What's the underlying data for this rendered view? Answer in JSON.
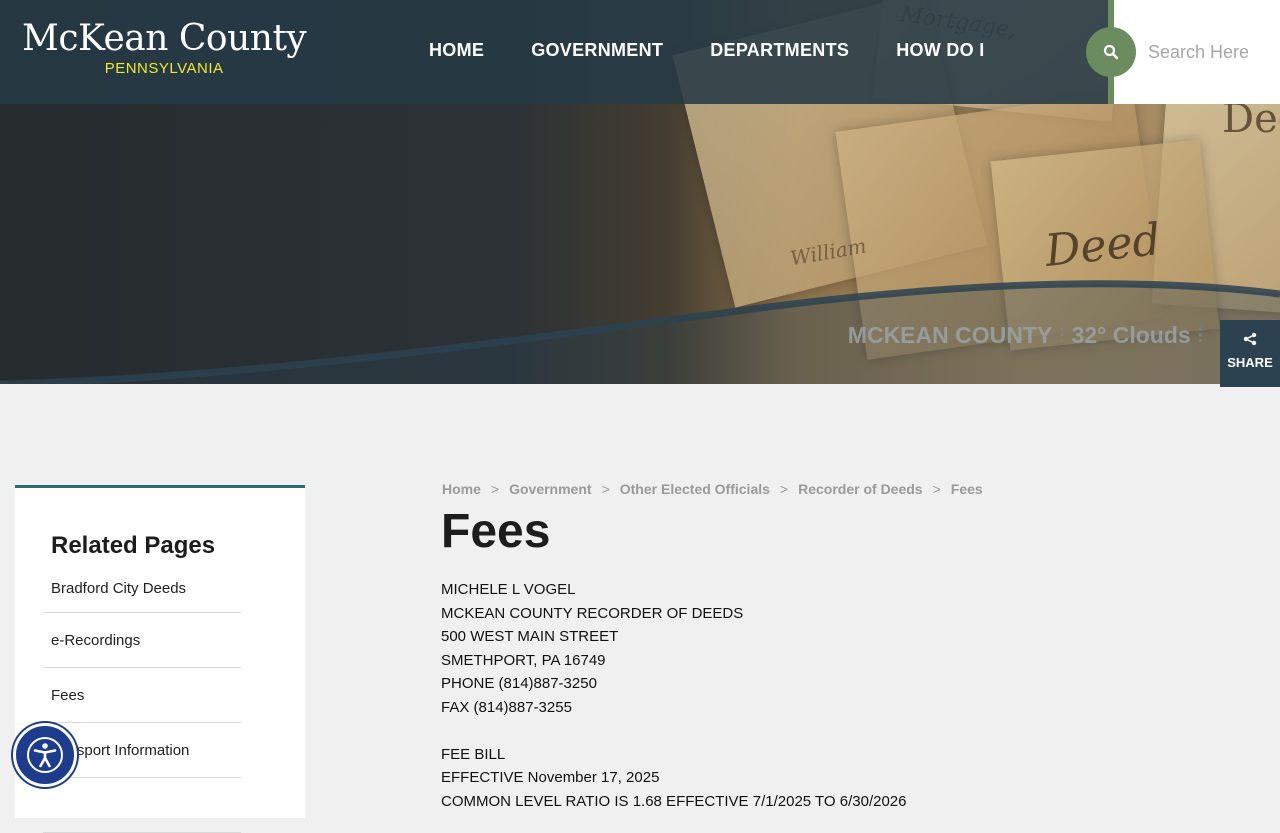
{
  "header": {
    "logo_title": "McKean County",
    "logo_subtitle": "PENNSYLVANIA",
    "nav": [
      "HOME",
      "GOVERNMENT",
      "DEPARTMENTS",
      "HOW DO I"
    ],
    "search_placeholder": "Search Here",
    "search_icon": "search-icon"
  },
  "hero": {
    "weather_location": "MCKEAN COUNTY",
    "weather_text": "32° Clouds",
    "separator": "⁝"
  },
  "share": {
    "label": "SHARE",
    "icon": "share-icon"
  },
  "sidebar": {
    "title": "Related Pages",
    "items": [
      "Bradford City Deeds",
      "e-Recordings",
      "Fees",
      "Passport Information",
      ""
    ]
  },
  "breadcrumb": [
    "Home",
    "Government",
    "Other Elected Officials",
    "Recorder of Deeds",
    "Fees"
  ],
  "breadcrumb_separator": ">",
  "page": {
    "title": "Fees",
    "address_lines": [
      "MICHELE L VOGEL",
      "MCKEAN COUNTY RECORDER OF DEEDS",
      "500 WEST MAIN STREET",
      "SMETHPORT, PA  16749",
      "PHONE (814)887-3250",
      "FAX (814)887-3255"
    ],
    "fee_lines": [
      "FEE BILL",
      "EFFECTIVE November 17, 2025",
      "COMMON LEVEL RATIO IS 1.68 EFFECTIVE 7/1/2025 TO 6/30/2026"
    ]
  },
  "colors": {
    "header_bg": "#263a46",
    "accent_green": "#6b8c5e",
    "logo_yellow": "#f0e92a",
    "sidebar_border": "#2d6a78",
    "a11y_blue": "#1e3c8c"
  }
}
